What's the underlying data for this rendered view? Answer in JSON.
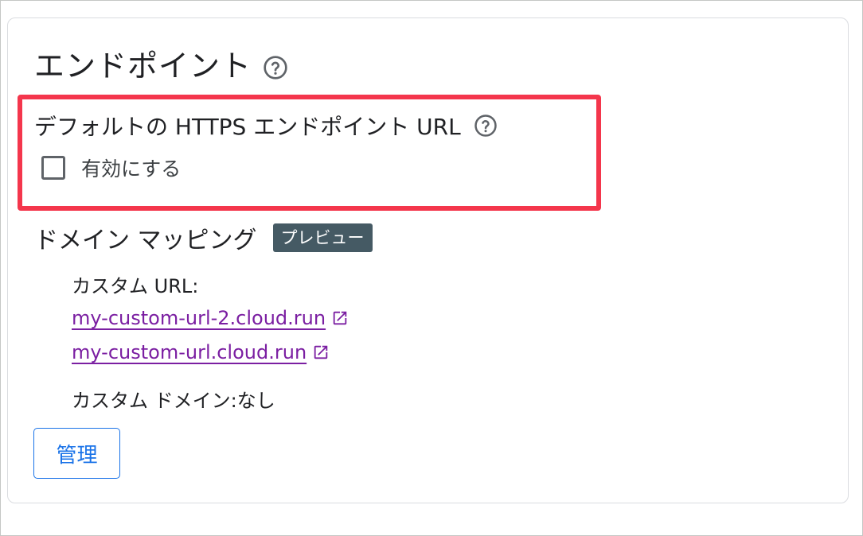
{
  "section": {
    "title": "エンドポイント"
  },
  "https_endpoint": {
    "label": "デフォルトの HTTPS エンドポイント URL",
    "checkbox_label": "有効にする",
    "checked": false
  },
  "domain_mapping": {
    "label": "ドメイン マッピング",
    "badge": "プレビュー",
    "custom_url_label": "カスタム URL:",
    "links": [
      "my-custom-url-2.cloud.run",
      "my-custom-url.cloud.run"
    ],
    "custom_domain_text": "カスタム ドメイン:なし"
  },
  "manage_button": {
    "label": "管理"
  },
  "colors": {
    "highlight": "#f4364c",
    "link": "#7b1fa2",
    "accent": "#1a73e8",
    "badge_bg": "#455a64"
  },
  "icons": [
    "help-icon",
    "open-in-new-icon"
  ]
}
